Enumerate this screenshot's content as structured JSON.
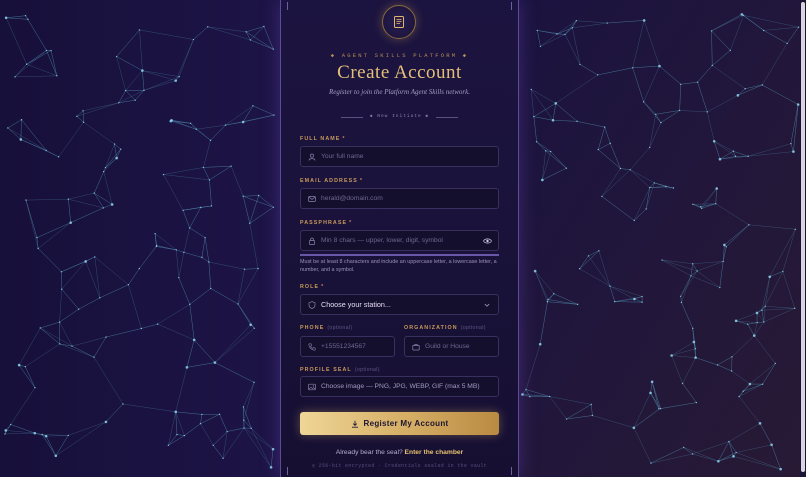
{
  "kicker": "◆ AGENT SKILLS PLATFORM ◆",
  "title": "Create Account",
  "subtitle": "Register to join the Platform Agent Skills network.",
  "divider_text": "◆ New Initiate ◆",
  "form": {
    "full_name": {
      "label": "FULL NAME",
      "required_mark": "*",
      "placeholder": "Your full name",
      "icon": "user-icon"
    },
    "email": {
      "label": "EMAIL ADDRESS",
      "required_mark": "*",
      "placeholder": "herald@domain.com",
      "icon": "mail-icon"
    },
    "passphrase": {
      "label": "PASSPHRASE",
      "required_mark": "*",
      "placeholder": "Min 8 chars — upper, lower, digit, symbol",
      "icon": "lock-icon",
      "toggle_icon": "eye-icon",
      "hint": "Must be at least 8 characters and include an uppercase letter, a lowercase letter, a number, and a symbol."
    },
    "role": {
      "label": "ROLE",
      "required_mark": "*",
      "selected": "Choose your station...",
      "icon": "shield-icon",
      "chevron_icon": "chevron-down-icon"
    },
    "phone": {
      "label": "PHONE",
      "optional_mark": "(optional)",
      "placeholder": "+15551234567",
      "icon": "phone-icon"
    },
    "organization": {
      "label": "ORGANIZATION",
      "optional_mark": "(optional)",
      "placeholder": "Guild or House",
      "icon": "briefcase-icon"
    },
    "profile_seal": {
      "label": "PROFILE SEAL",
      "optional_mark": "(optional)",
      "value": "Choose image — PNG, JPG, WEBP, GIF (max 5 MB)",
      "icon": "image-icon"
    }
  },
  "submit_label": "Register My Account",
  "signin_prompt": "Already bear the seal?",
  "signin_link": "Enter the chamber",
  "footer": "◎ 256-bit encrypted · Credentials sealed in the vault",
  "colors": {
    "accent_gold": "#e5bf79",
    "background": "#120c2a",
    "panel": "#1c1440"
  }
}
